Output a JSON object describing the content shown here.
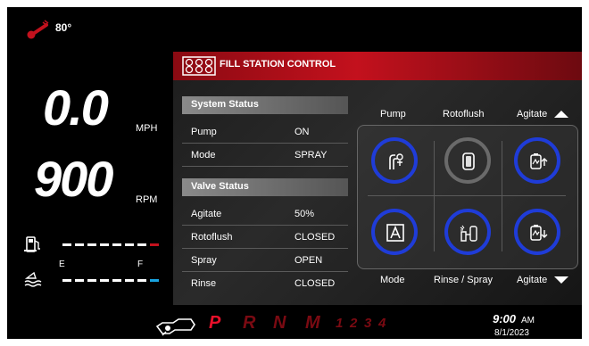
{
  "temperature": {
    "icon": "thermometer-icon",
    "value": "80°"
  },
  "gauges": {
    "speed": {
      "value": "0.0",
      "unit": "MPH"
    },
    "rpm": {
      "value": "900",
      "unit": "RPM"
    }
  },
  "fluid": {
    "fuel_icon": "fuel-pump-icon",
    "def_icon": "water-level-icon",
    "empty_label": "E",
    "full_label": "F"
  },
  "panel": {
    "title": "FILL STATION CONTROL",
    "header_icon": "fill-station-icon",
    "system_status": {
      "heading": "System Status",
      "rows": [
        {
          "label": "Pump",
          "value": "ON"
        },
        {
          "label": "Mode",
          "value": "SPRAY"
        }
      ]
    },
    "valve_status": {
      "heading": "Valve Status",
      "rows": [
        {
          "label": "Agitate",
          "value": "50%"
        },
        {
          "label": "Rotoflush",
          "value": "CLOSED"
        },
        {
          "label": "Spray",
          "value": "OPEN"
        },
        {
          "label": "Rinse",
          "value": "CLOSED"
        }
      ]
    },
    "buttons": {
      "pump_label": "Pump",
      "rotoflush_label": "Rotoflush",
      "agitate_up_label": "Agitate",
      "mode_label": "Mode",
      "rinse_spray_label": "Rinse / Spray",
      "agitate_down_label": "Agitate"
    }
  },
  "bottom": {
    "transmission_icon": "transmission-icon",
    "gears": [
      "P",
      "R",
      "N",
      "M",
      "1",
      "2",
      "3",
      "4"
    ],
    "time": "9:00",
    "ampm": "AM",
    "date": "8/1/2023"
  },
  "colors": {
    "accent_red": "#c3111d",
    "active_blue": "#1f3cd8",
    "def_blue": "#19a3e0"
  }
}
